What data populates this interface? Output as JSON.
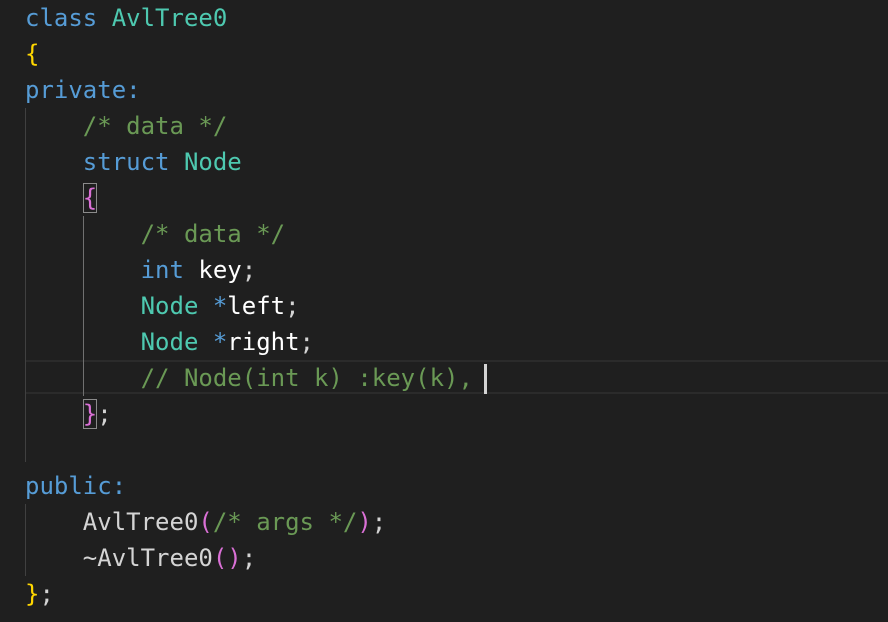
{
  "code": {
    "l1": {
      "kw": "class",
      "name": "AvlTree0"
    },
    "l2": {
      "open_brace": "{"
    },
    "l3": {
      "label": "private:"
    },
    "l4": {
      "comment": "/* data */"
    },
    "l5": {
      "kw": "struct",
      "name": "Node"
    },
    "l6": {
      "open_brace": "{"
    },
    "l7": {
      "comment": "/* data */"
    },
    "l8": {
      "type": "int",
      "var": "key",
      "semi": ";"
    },
    "l9": {
      "type": "Node",
      "ptr": "*",
      "var": "left",
      "semi": ";"
    },
    "l10": {
      "type": "Node",
      "ptr": "*",
      "var": "right",
      "semi": ";"
    },
    "l11": {
      "comment": "// Node(int k) :key(k),"
    },
    "l12": {
      "close_brace": "}",
      "semi": ";"
    },
    "l14": {
      "label": "public:"
    },
    "l15": {
      "fn": "AvlTree0",
      "open_paren": "(",
      "comment": "/* args */",
      "close_paren": ")",
      "semi": ";"
    },
    "l16": {
      "fn": "~AvlTree0",
      "open_paren": "(",
      "close_paren": ")",
      "semi": ";"
    },
    "l17": {
      "close_brace": "}",
      "semi": ";"
    }
  },
  "theme": {
    "background": "#1f1f1f",
    "keyword": "#569cd6",
    "type": "#4ec9b0",
    "comment": "#6a9955",
    "bracket_level1": "#ffd700",
    "bracket_level2": "#da70d6"
  }
}
